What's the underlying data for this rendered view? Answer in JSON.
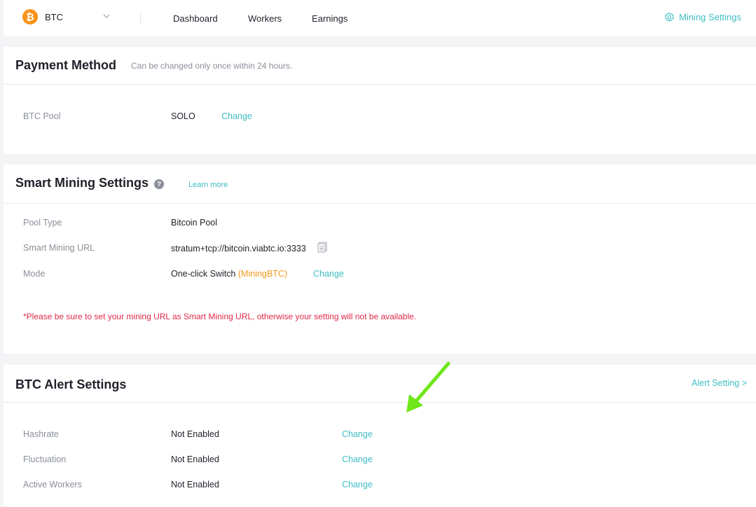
{
  "topbar": {
    "coin": {
      "symbol": "₿",
      "name": "BTC"
    },
    "nav": [
      "Dashboard",
      "Workers",
      "Earnings"
    ],
    "mining_settings": "Mining Settings"
  },
  "payment": {
    "title": "Payment Method",
    "note": "Can be changed only once within 24 hours.",
    "rows": [
      {
        "label": "BTC Pool",
        "value": "SOLO",
        "action": "Change"
      }
    ]
  },
  "smart": {
    "title": "Smart Mining Settings",
    "help": "?",
    "learn_more": "Learn more",
    "rows": [
      {
        "label": "Pool Type",
        "value": "Bitcoin Pool"
      },
      {
        "label": "Smart Mining URL",
        "value": "stratum+tcp://bitcoin.viabtc.io:3333"
      },
      {
        "label": "Mode",
        "value": "One-click Switch",
        "value_extra": "(MiningBTC)",
        "action": "Change"
      }
    ],
    "warning": "*Please be sure to set your mining URL as Smart Mining URL, otherwise your setting will not be available."
  },
  "alert": {
    "title": "BTC Alert Settings",
    "setting_link": "Alert Setting >",
    "rows": [
      {
        "label": "Hashrate",
        "value": "Not Enabled",
        "action": "Change"
      },
      {
        "label": "Fluctuation",
        "value": "Not Enabled",
        "action": "Change"
      },
      {
        "label": "Active Workers",
        "value": "Not Enabled",
        "action": "Change"
      }
    ]
  },
  "colors": {
    "accent": "#3ebcc3",
    "bitcoin": "#f7931a",
    "warning": "#e0284a",
    "highlight": "#f29a1c",
    "annotation_arrow": "#6ee61a"
  },
  "icons": [
    "bitcoin-icon",
    "chevron-down-icon",
    "gear-icon",
    "help-icon",
    "copy-icon",
    "green-arrow-icon"
  ]
}
